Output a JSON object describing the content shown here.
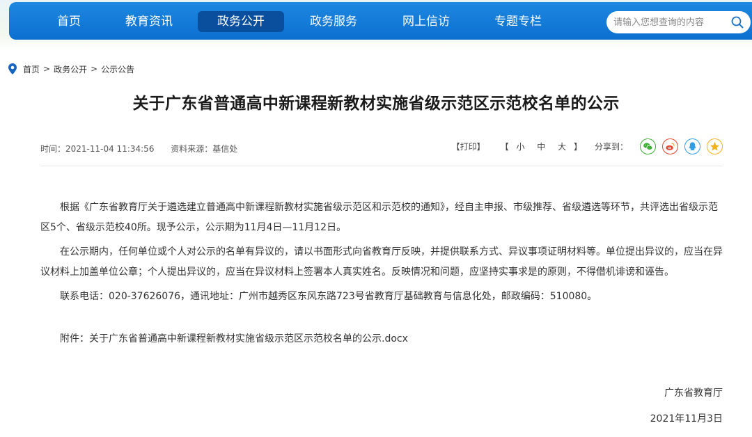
{
  "nav": {
    "items": [
      {
        "label": "首页",
        "active": false
      },
      {
        "label": "教育资讯",
        "active": false
      },
      {
        "label": "政务公开",
        "active": true
      },
      {
        "label": "政务服务",
        "active": false
      },
      {
        "label": "网上信访",
        "active": false
      },
      {
        "label": "专题专栏",
        "active": false
      }
    ],
    "search": {
      "placeholder": "请输入您想查询的内容",
      "value": ""
    }
  },
  "breadcrumb": {
    "items": [
      "首页",
      "政务公开",
      "公示公告"
    ],
    "separator": ">"
  },
  "article": {
    "title": "关于广东省普通高中新课程新教材实施省级示范区示范校名单的公示",
    "time": "时间：2021-11-04 11:34:56",
    "source": "资料来源：基信处",
    "paragraphs": [
      "根据《广东省教育厅关于遴选建立普通高中新课程新教材实施省级示范区和示范校的通知》，经自主申报、市级推荐、省级遴选等环节，共评选出省级示范区5个、省级示范校40所。现予公示，公示期为11月4日—11月12日。",
      "在公示期内，任何单位或个人对公示的名单有异议的，请以书面形式向省教育厅反映，并提供联系方式、异议事项证明材料等。单位提出异议的，应当在异议材料上加盖单位公章；个人提出异议的，应当在异议材料上签署本人真实姓名。反映情况和问题，应坚持实事求是的原则，不得借机诽谤和诬告。",
      "联系电话：020-37626076，通讯地址：广州市越秀区东风东路723号省教育厅基础教育与信息化处，邮政编码：510080。"
    ],
    "attachment": "附件：关于广东省普通高中新课程新教材实施省级示范区示范校名单的公示.docx",
    "signature": "广东省教育厅",
    "date": "2021年11月3日"
  },
  "tools": {
    "print": "【打印】",
    "font_open": "【",
    "font_small": "小",
    "font_medium": "中",
    "font_large": "大",
    "font_close": "】",
    "share_label": "分享到："
  },
  "share": [
    {
      "icon": "wechat-icon",
      "color": "#3cb034"
    },
    {
      "icon": "weibo-icon",
      "color": "#e6462f"
    },
    {
      "icon": "qq-icon",
      "color": "#2d9ee6"
    },
    {
      "icon": "qzone-icon",
      "color": "#f2b21a"
    }
  ],
  "colors": {
    "nav_bg": "#0c6fd0",
    "nav_active": "#0a4f9e",
    "pin": "#1565c0"
  }
}
